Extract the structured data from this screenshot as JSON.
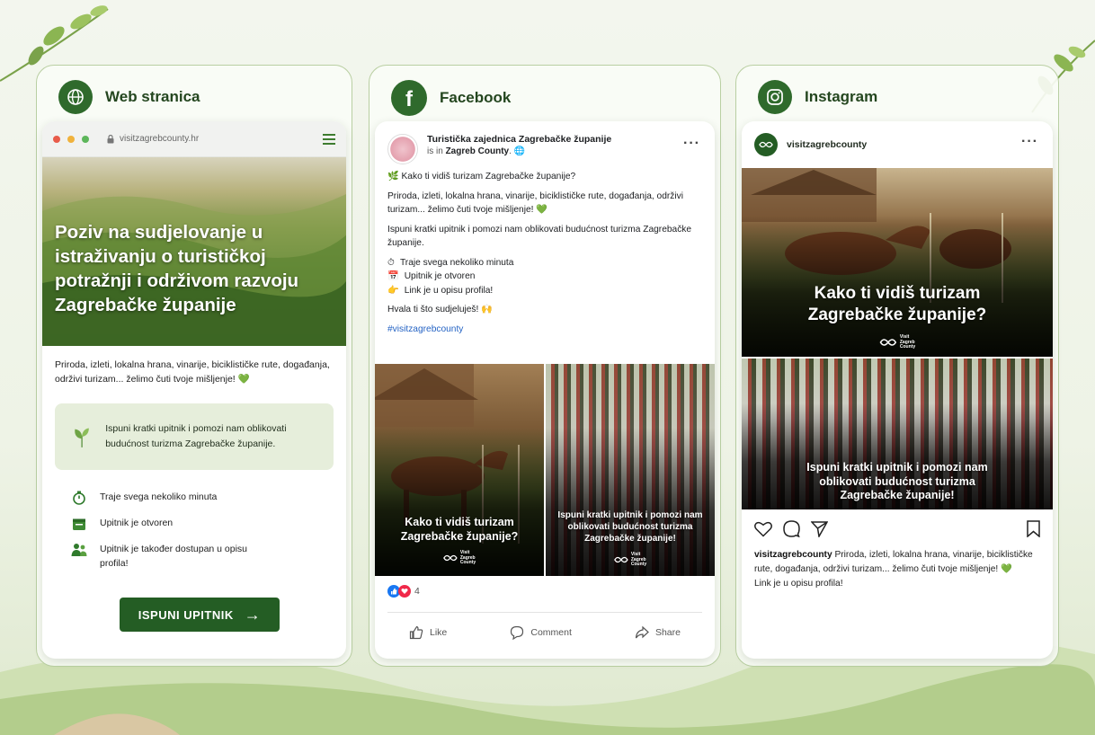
{
  "colors": {
    "brand_green": "#245d24",
    "header_green": "#2f6a2c",
    "light_green": "#e6eedb",
    "link_blue": "#2463c4"
  },
  "web": {
    "header": "Web stranica",
    "url": "visitzagrebcounty.hr",
    "hero_title": "Poziv na sudjelovanje u istraživanju o turističkoj potražnji i održivom razvoju Zagrebačke županije",
    "intro": "Priroda, izleti, lokalna hrana, vinarije, biciklističke rute, događanja, održivi turizam... želimo čuti tvoje mišljenje! 💚",
    "box_text": "Ispuni kratki upitnik i pomozi nam oblikovati budućnost turizma Zagrebačke županije.",
    "features": [
      {
        "icon": "stopwatch-icon",
        "text": "Traje svega nekoliko minuta"
      },
      {
        "icon": "calendar-icon",
        "text": "Upitnik je otvoren"
      },
      {
        "icon": "people-icon",
        "text": "Upitnik je također dostupan u opisu profila!"
      }
    ],
    "cta_label": "ISPUNI UPITNIK",
    "cta_arrow": "→"
  },
  "facebook": {
    "header": "Facebook",
    "page_name": "Turistička zajednica Zagrebačke županije",
    "sub_prefix": "is in ",
    "sub_location": "Zagreb County",
    "sub_suffix": ". 🌐",
    "more": "···",
    "line1": "🌿 Kako ti vidiš turizam Zagrebačke županije?",
    "line2": "Priroda, izleti, lokalna hrana, vinarije, biciklističke rute, događanja, održivi turizam... želimo čuti tvoje mišljenje! 💚",
    "line3": "Ispuni kratki upitnik i pomozi nam oblikovati budućnost turizma Zagrebačke županije.",
    "list": [
      {
        "icon": "⏱",
        "text": "Traje svega nekoliko minuta"
      },
      {
        "icon": "📅",
        "text": "Upitnik je otvoren"
      },
      {
        "icon": "👉",
        "text": "Link je u opisu profila!"
      }
    ],
    "thanks": "Hvala ti što sudjeluješ! 🙌",
    "hashtag": "#visitzagrebcounty",
    "img1_caption": "Kako ti vidiš turizam Zagrebačke županije?",
    "img2_caption": "Ispuni kratki upitnik i pomozi nam oblikovati budućnost turizma Zagrebačke županije!",
    "logo_text": [
      "Visit",
      "Zagreb",
      "County"
    ],
    "reaction_count": "4",
    "actions": {
      "like": "Like",
      "comment": "Comment",
      "share": "Share"
    }
  },
  "instagram": {
    "header": "Instagram",
    "username": "visitzagrebcounty",
    "more": "···",
    "top_caption": "Kako ti vidiš turizam Zagrebačke županije?",
    "bottom_caption": "Ispuni kratki upitnik i pomozi nam oblikovati budućnost turizma Zagrebačke županije!",
    "logo_text": [
      "Visit",
      "Zagreb",
      "County"
    ],
    "caption_user": "visitzagrebcounty",
    "caption_text": " Priroda, izleti, lokalna hrana, vinarije, biciklističke rute, događanja, održivi turizam... želimo čuti tvoje mišljenje! 💚",
    "caption_link": "Link je u opisu profila!"
  }
}
